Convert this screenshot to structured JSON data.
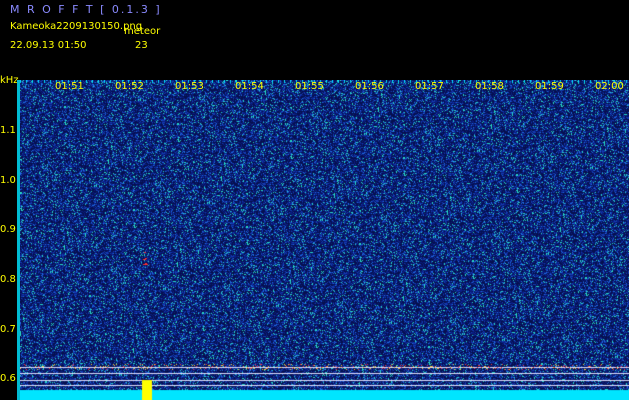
{
  "header": {
    "app_title": "M R O F F T [ 0.1.3 ]",
    "filename": "Kameoka2209130150.png",
    "datetime": "22.09.13 01:50",
    "event_label": "meteor",
    "event_count": "23"
  },
  "axis": {
    "unit": "kHz",
    "time_ticks": [
      "01:51",
      "01:52",
      "01:53",
      "01:54",
      "01:55",
      "01:56",
      "01:57",
      "01:58",
      "01:59",
      "02:00"
    ],
    "freq_ticks": [
      "1.1",
      "1.0",
      "0.9",
      "0.8",
      "0.7",
      "0.6"
    ]
  },
  "colors": {
    "background": "#000000",
    "label": "#ffff00",
    "title": "#8a8aff",
    "spectrum_base": "#0a1a6e",
    "noise_floor": "#00e5ff",
    "signal": "#ff3333"
  }
}
